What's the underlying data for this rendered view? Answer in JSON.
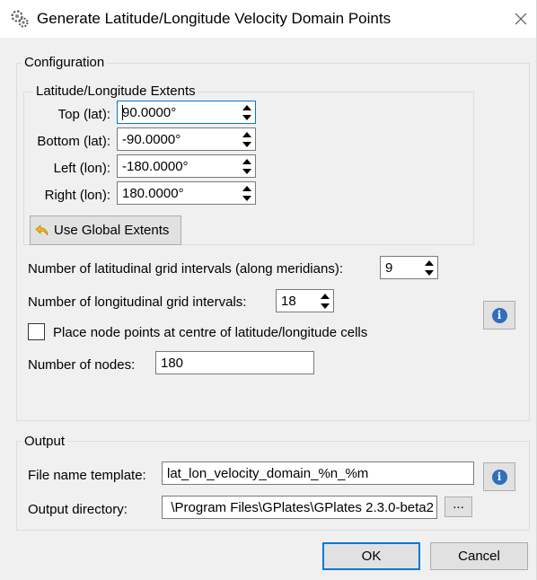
{
  "window": {
    "title": "Generate Latitude/Longitude Velocity Domain Points",
    "icon": "gears-icon",
    "close_icon": "close-icon"
  },
  "configuration": {
    "group_title": "Configuration",
    "extents": {
      "group_title": "Latitude/Longitude Extents",
      "top": {
        "label": "Top (lat):",
        "value": "90.0000°"
      },
      "bottom": {
        "label": "Bottom (lat):",
        "value": "-90.0000°"
      },
      "left": {
        "label": "Left (lon):",
        "value": "-180.0000°"
      },
      "right": {
        "label": "Right (lon):",
        "value": "180.0000°"
      },
      "use_global_button": "Use Global Extents"
    },
    "lat_intervals": {
      "label": "Number of latitudinal grid intervals (along meridians):",
      "value": "9"
    },
    "lon_intervals": {
      "label": "Number of longitudinal grid intervals:",
      "value": "18"
    },
    "centre_cells": {
      "label": "Place node points at centre of latitude/longitude cells",
      "checked": false
    },
    "nodes": {
      "label": "Number of nodes:",
      "value": "180"
    }
  },
  "output": {
    "group_title": "Output",
    "file_template": {
      "label": "File name template:",
      "value": "lat_lon_velocity_domain_%n_%m"
    },
    "directory": {
      "label": "Output directory:",
      "value": "\\Program Files\\GPlates\\GPlates 2.3.0-beta2",
      "browse_label": "..."
    }
  },
  "buttons": {
    "ok": "OK",
    "cancel": "Cancel"
  },
  "colors": {
    "focus": "#0078d7",
    "info": "#2f6fba",
    "arrow_icon": "#f2b90c"
  }
}
